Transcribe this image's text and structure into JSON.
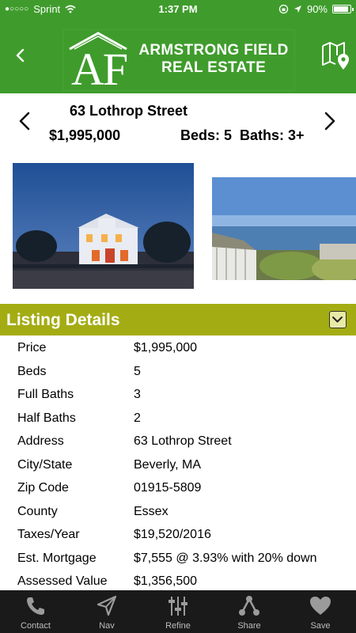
{
  "status": {
    "carrier": "Sprint",
    "time": "1:37 PM",
    "battery": "90%"
  },
  "header": {
    "logo_initials": "AF",
    "logo_line1": "ARMSTRONG FIELD",
    "logo_line2": "REAL ESTATE",
    "brand_color": "#3f9c2c"
  },
  "property": {
    "address": "63 Lothrop Street",
    "price": "$1,995,000",
    "beds_baths": "Beds: 5  Baths: 3+"
  },
  "section": {
    "title": "Listing Details",
    "accent_color": "#a4ac13"
  },
  "details": [
    {
      "label": "Price",
      "value": "$1,995,000"
    },
    {
      "label": "Beds",
      "value": "5"
    },
    {
      "label": "Full Baths",
      "value": "3"
    },
    {
      "label": "Half Baths",
      "value": "2"
    },
    {
      "label": "Address",
      "value": "63 Lothrop Street"
    },
    {
      "label": "City/State",
      "value": "Beverly, MA"
    },
    {
      "label": "Zip Code",
      "value": "01915-5809"
    },
    {
      "label": "County",
      "value": "Essex"
    },
    {
      "label": "Taxes/Year",
      "value": "$19,520/2016"
    },
    {
      "label": "Est. Mortgage",
      "value": "$7,555 @ 3.93% with 20% down"
    },
    {
      "label": "Assessed Value",
      "value": "$1,356,500"
    }
  ],
  "tabs": [
    {
      "label": "Contact",
      "icon": "phone-icon"
    },
    {
      "label": "Nav",
      "icon": "navigation-arrow-icon"
    },
    {
      "label": "Refine",
      "icon": "sliders-icon"
    },
    {
      "label": "Share",
      "icon": "share-icon"
    },
    {
      "label": "Save",
      "icon": "heart-icon"
    }
  ]
}
